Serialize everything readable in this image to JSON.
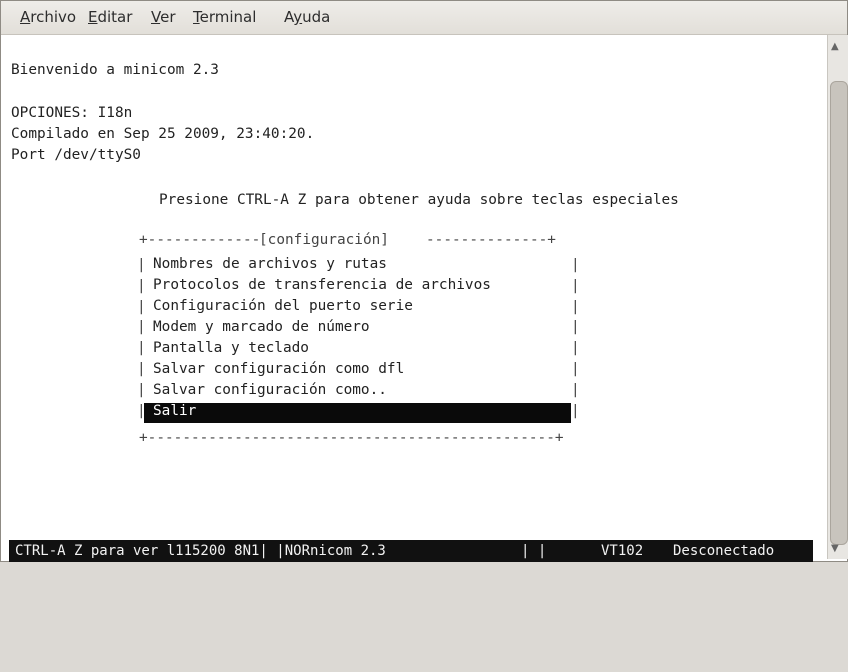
{
  "menubar": {
    "items": [
      {
        "label": "Archivo",
        "mnemonic": "A"
      },
      {
        "label": "Editar",
        "mnemonic": "E"
      },
      {
        "label": "Ver",
        "mnemonic": "V"
      },
      {
        "label": "Terminal",
        "mnemonic": "T"
      },
      {
        "label": "Ayuda",
        "mnemonic": "y"
      }
    ]
  },
  "terminal": {
    "welcome": "Bienvenido a minicom 2.3",
    "options": "OPCIONES: I18n",
    "compiled": "Compilado en Sep 25 2009, 23:40:20.",
    "port": "Port /dev/ttyS0",
    "help_hint": "Presione CTRL-A Z para obtener ayuda sobre teclas especiales"
  },
  "config_menu": {
    "title": "[configuración]",
    "items": [
      "Nombres de archivos y rutas",
      "Protocolos de transferencia de archivos",
      "Configuración del puerto serie",
      "Modem y marcado de número",
      "Pantalla y teclado",
      "Salvar configuración como dfl",
      "Salvar configuración como..",
      "Salir"
    ],
    "selected_index": 7
  },
  "status_bar": {
    "help": "CTRL-A Z para ver l115200 8N1| |NORnicom 2.3",
    "flags": "| |",
    "emulation": "VT102",
    "connection": "Desconectado"
  },
  "colors": {
    "menubar_bg": "#e6e3de",
    "terminal_bg": "#ffffff",
    "status_bg": "#111111",
    "selection_bg": "#0a0a0a"
  },
  "icons": [
    "scroll-up-arrow-icon",
    "scroll-down-arrow-icon"
  ]
}
